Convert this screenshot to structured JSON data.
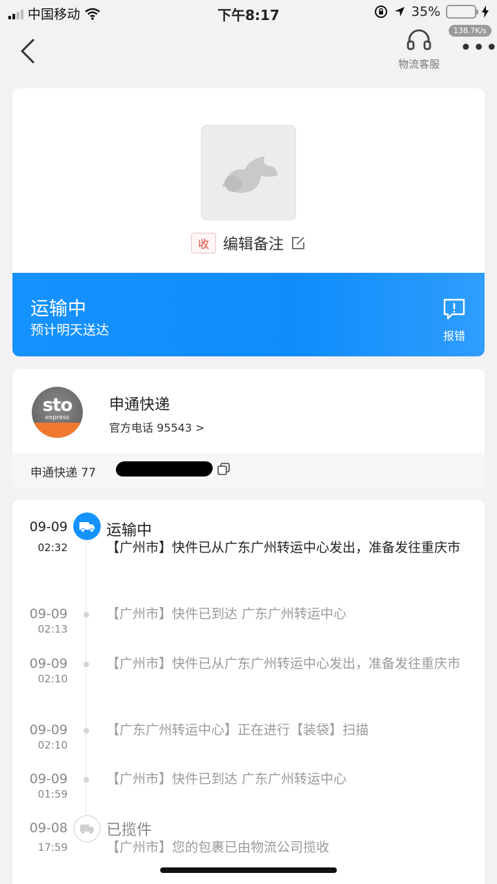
{
  "status_bar": {
    "carrier": "中国移动",
    "time": "下午8:17",
    "battery": "35%",
    "battery_level": 0.35,
    "net_speed": "138.7K/s"
  },
  "nav": {
    "customer_service_label": "物流客服"
  },
  "package": {
    "received_tag": "收",
    "edit_note_label": "编辑备注"
  },
  "status": {
    "title": "运输中",
    "subtitle": "预计明天送达",
    "report_label": "报错",
    "colors": {
      "band": "#1592ff"
    }
  },
  "courier": {
    "name": "申通快递",
    "phone_label": "官方电话 95543 >",
    "tracking_label": "申通快递 77",
    "logo_text": "sto",
    "logo_subtext": "express"
  },
  "timeline": [
    {
      "date": "09-09",
      "time": "02:32",
      "title": "运输中",
      "text": "【广州市】快件已从广东广州转运中心发出，准备发往重庆市",
      "state": "active"
    },
    {
      "date": "09-09",
      "time": "02:13",
      "title": "",
      "text": "【广州市】快件已到达 广东广州转运中心",
      "state": "past"
    },
    {
      "date": "09-09",
      "time": "02:10",
      "title": "",
      "text": "【广州市】快件已从广东广州转运中心发出，准备发往重庆市",
      "state": "past"
    },
    {
      "date": "09-09",
      "time": "02:10",
      "title": "",
      "text": "【广东广州转运中心】正在进行【装袋】扫描",
      "state": "past"
    },
    {
      "date": "09-09",
      "time": "01:59",
      "title": "",
      "text": "【广州市】快件已到达 广东广州转运中心",
      "state": "past"
    },
    {
      "date": "09-08",
      "time": "17:59",
      "title": "已揽件",
      "text": "【广州市】您的包裹已由物流公司揽收",
      "state": "pickup"
    }
  ]
}
